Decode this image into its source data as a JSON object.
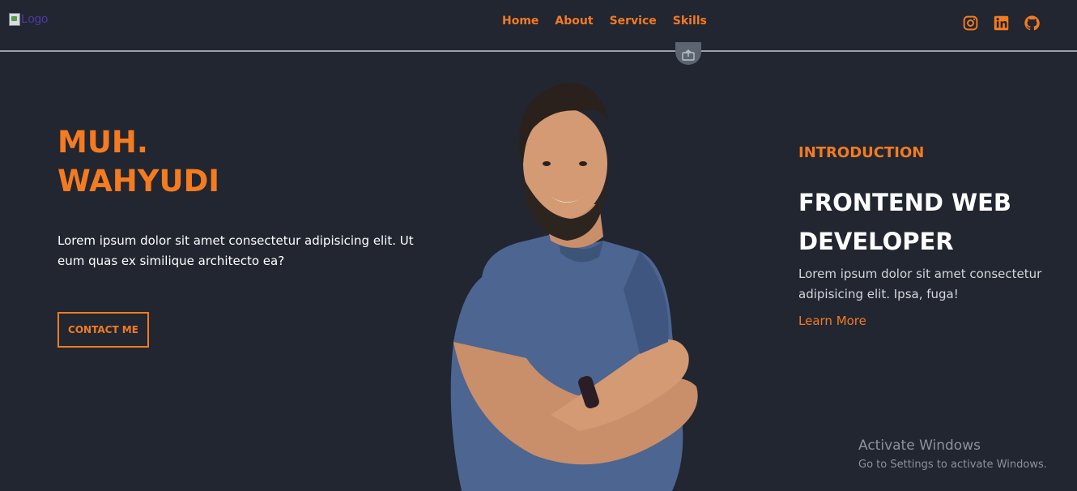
{
  "header": {
    "logo_alt": "Logo",
    "nav": [
      "Home",
      "About",
      "Service",
      "Skills"
    ],
    "socials": [
      "instagram-icon",
      "linkedin-icon",
      "github-icon"
    ]
  },
  "hero": {
    "name_line1": "MUH.",
    "name_line2": "WAHYUDI",
    "description": "Lorem ipsum dolor sit amet consectetur adipisicing elit. Ut eum quas ex similique architecto ea?",
    "contact_button": "CONTACT ME"
  },
  "intro": {
    "label": "INTRODUCTION",
    "title_line1": "FRONTEND WEB",
    "title_line2": "DEVELOPER",
    "text": "Lorem ipsum dolor sit amet consectetur adipisicing elit. Ipsa, fuga!",
    "link": "Learn More"
  },
  "watermark": {
    "title": "Activate Windows",
    "subtitle": "Go to Settings to activate Windows."
  },
  "colors": {
    "background": "#212631",
    "accent": "#f47b20",
    "text": "#ffffff"
  }
}
